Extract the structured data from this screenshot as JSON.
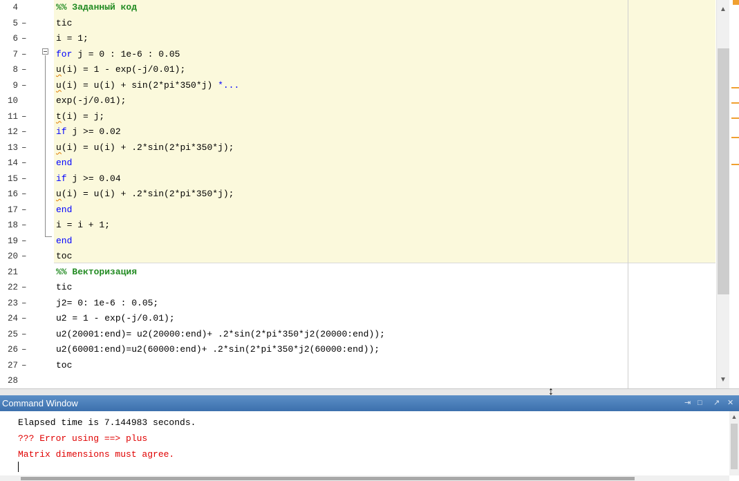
{
  "editor": {
    "lines": [
      {
        "num": "4",
        "dash": "",
        "segments": [
          {
            "t": "%% Заданный код",
            "c": "comment"
          }
        ]
      },
      {
        "num": "5",
        "dash": "–",
        "segments": [
          {
            "t": "tic"
          }
        ]
      },
      {
        "num": "6",
        "dash": "–",
        "segments": [
          {
            "t": "i = 1;"
          }
        ]
      },
      {
        "num": "7",
        "dash": "–",
        "segments": [
          {
            "t": "for",
            "c": "kw"
          },
          {
            "t": " j = 0 : 1e-6 : 0.05"
          }
        ]
      },
      {
        "num": "8",
        "dash": "–",
        "segments": [
          {
            "t": "u",
            "c": "sq"
          },
          {
            "t": "(i) = 1 - exp(-j/0.01);"
          }
        ]
      },
      {
        "num": "9",
        "dash": "–",
        "segments": [
          {
            "t": "u",
            "c": "sq"
          },
          {
            "t": "(i) = u(i) + sin(2*pi*350*j) "
          },
          {
            "t": "*...",
            "c": "kw"
          }
        ]
      },
      {
        "num": "10",
        "dash": "",
        "segments": [
          {
            "t": "exp(-j/0.01);"
          }
        ]
      },
      {
        "num": "11",
        "dash": "–",
        "segments": [
          {
            "t": "t",
            "c": "sq"
          },
          {
            "t": "(i) = j;"
          }
        ]
      },
      {
        "num": "12",
        "dash": "–",
        "segments": [
          {
            "t": "if",
            "c": "kw"
          },
          {
            "t": " j >= 0.02"
          }
        ]
      },
      {
        "num": "13",
        "dash": "–",
        "segments": [
          {
            "t": "u",
            "c": "sq"
          },
          {
            "t": "(i) = u(i) + .2*sin(2*pi*350*j);"
          }
        ]
      },
      {
        "num": "14",
        "dash": "–",
        "segments": [
          {
            "t": "end",
            "c": "kw"
          }
        ]
      },
      {
        "num": "15",
        "dash": "–",
        "segments": [
          {
            "t": "if",
            "c": "kw"
          },
          {
            "t": " j >= 0.04"
          }
        ]
      },
      {
        "num": "16",
        "dash": "–",
        "segments": [
          {
            "t": "u",
            "c": "sq"
          },
          {
            "t": "(i) = u(i) + .2*sin(2*pi*350*j);"
          }
        ]
      },
      {
        "num": "17",
        "dash": "–",
        "segments": [
          {
            "t": "end",
            "c": "kw"
          }
        ]
      },
      {
        "num": "18",
        "dash": "–",
        "segments": [
          {
            "t": "i = i + 1;"
          }
        ]
      },
      {
        "num": "19",
        "dash": "–",
        "segments": [
          {
            "t": "end",
            "c": "kw"
          }
        ]
      },
      {
        "num": "20",
        "dash": "–",
        "segments": [
          {
            "t": "toc"
          }
        ]
      },
      {
        "num": "21",
        "dash": "",
        "segments": [
          {
            "t": "%% Векторизация",
            "c": "comment"
          }
        ]
      },
      {
        "num": "22",
        "dash": "–",
        "segments": [
          {
            "t": "tic"
          }
        ]
      },
      {
        "num": "23",
        "dash": "–",
        "segments": [
          {
            "t": "j2= 0: 1e-6 : 0.05;"
          }
        ]
      },
      {
        "num": "24",
        "dash": "–",
        "segments": [
          {
            "t": "u2 = 1 - exp(-j/0.01);"
          }
        ]
      },
      {
        "num": "25",
        "dash": "–",
        "segments": [
          {
            "t": "u2(20001:end)= u2(20000:end)+ .2*sin(2*pi*350*j2(20000:end));"
          }
        ]
      },
      {
        "num": "26",
        "dash": "–",
        "segments": [
          {
            "t": "u2(60001:end)=u2(60000:end)+ .2*sin(2*pi*350*j2(60000:end));"
          }
        ]
      },
      {
        "num": "27",
        "dash": "–",
        "segments": [
          {
            "t": "toc"
          }
        ]
      },
      {
        "num": "28",
        "dash": "",
        "segments": []
      }
    ],
    "scroll_up_icon": "chevron-up-icon",
    "scroll_down_icon": "chevron-down-icon"
  },
  "command_window": {
    "title": "Command Window",
    "controls": {
      "undock": "⇥",
      "maximize": "□",
      "pin": "↗",
      "close": "✕"
    },
    "output": [
      {
        "text": "Elapsed time is 7.144983 seconds.",
        "color": "#000000"
      },
      {
        "text": "??? Error using ==> plus",
        "color": "#e00000"
      },
      {
        "text": "Matrix dimensions must agree.",
        "color": "#e00000"
      }
    ]
  },
  "colors": {
    "cell_highlight": "#fbf9dc",
    "keyword": "#0000ff",
    "comment": "#228b22",
    "error": "#e00000",
    "title_bar": "#4a7fbd"
  }
}
